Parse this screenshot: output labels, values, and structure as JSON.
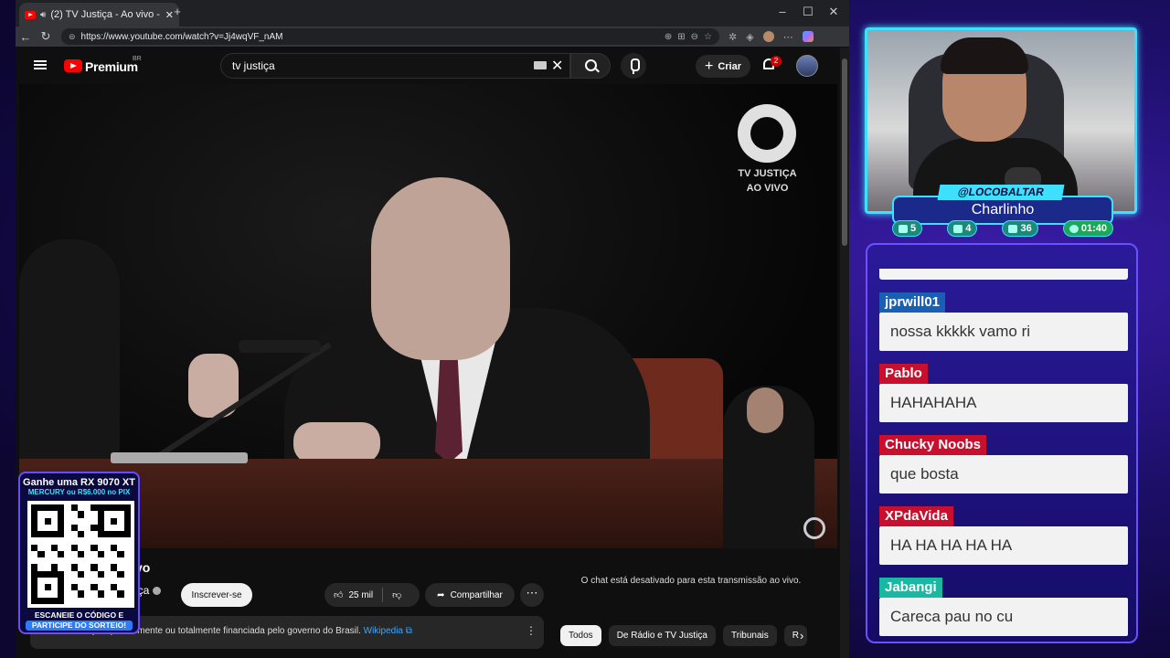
{
  "browser": {
    "tab_title": "(2) TV Justiça - Ao vivo - You",
    "url": "https://www.youtube.com/watch?v=Jj4wqVF_nAM"
  },
  "youtube": {
    "wordmark": "Premium",
    "region": "BR",
    "search_value": "tv justiça",
    "create_label": "Criar",
    "notifications": "2"
  },
  "video": {
    "overlay_line1": "TV JUSTIÇA",
    "overlay_line2": "AO VIVO",
    "title": "vo",
    "channel": "iça",
    "subscribe_label": "Inscrever-se",
    "likes": "25 mil",
    "share_label": "Compartilhar",
    "chat_disabled": "O chat está desativado para esta transmissão ao vivo.",
    "info_text": "TV Justiça é parcialmente ou totalmente financiada pelo governo do Brasil.",
    "info_link": "Wikipedia",
    "chips": [
      "Todos",
      "De Rádio e TV Justiça",
      "Tribunais",
      "R"
    ]
  },
  "promo": {
    "line1": "Ganhe uma RX 9070 XT",
    "line2": "MERCURY ou R$6.000 no PIX",
    "line3": "ESCANEIE O CÓDIGO E",
    "line4": "PARTICIPE DO SORTEIO!"
  },
  "streamer": {
    "handle": "@LOCOBALTAR",
    "name": "Charlinho",
    "stats": {
      "twitch": "5",
      "youtube": "4",
      "kick": "36",
      "timer": "01:40"
    }
  },
  "chat": [
    {
      "user": "jprwill01",
      "color": "#1b5fb5",
      "text": "nossa kkkkk vamo ri"
    },
    {
      "user": "Pablo",
      "color": "#c8102e",
      "text": "HAHAHAHA"
    },
    {
      "user": "Chucky Noobs",
      "color": "#c8102e",
      "text": "que bosta"
    },
    {
      "user": "XPdaVida",
      "color": "#c8102e",
      "text": "HA HA HA HA HA"
    },
    {
      "user": "Jabangi",
      "color": "#19b8a2",
      "text": "Careca pau no cu"
    }
  ],
  "colors": {
    "accent_cyan": "#3ee0ff",
    "youtube_red": "#ff0000",
    "chat_border": "#6a50ff"
  }
}
